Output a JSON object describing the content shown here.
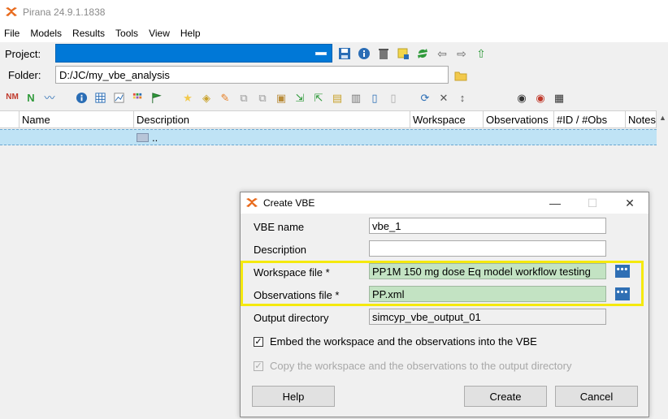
{
  "window": {
    "title": "Pirana 24.9.1.1838"
  },
  "menu": [
    "File",
    "Models",
    "Results",
    "Tools",
    "View",
    "Help"
  ],
  "project": {
    "label": "Project:",
    "value": ""
  },
  "folder": {
    "label": "Folder:",
    "value": "D:/JC/my_vbe_analysis"
  },
  "table": {
    "columns": [
      "Name",
      "Description",
      "Workspace",
      "Observations",
      "#ID / #Obs",
      "Notes"
    ],
    "parent_row": {
      "description": ".."
    }
  },
  "dialog": {
    "title": "Create VBE",
    "vbe_name": {
      "label": "VBE name",
      "value": "vbe_1"
    },
    "description": {
      "label": "Description",
      "value": ""
    },
    "workspace_file": {
      "label": "Workspace file *",
      "value": "PP1M 150 mg dose Eq model workflow testing"
    },
    "observations_file": {
      "label": "Observations file *",
      "value": "PP.xml"
    },
    "output_directory": {
      "label": "Output directory",
      "value": "simcyp_vbe_output_01"
    },
    "embed_checkbox": {
      "label": "Embed the workspace and the observations into the VBE",
      "checked": true
    },
    "copy_checkbox": {
      "label": "Copy the workspace and the observations to the output directory",
      "checked": true,
      "disabled": true
    },
    "buttons": {
      "help": "Help",
      "create": "Create",
      "cancel": "Cancel"
    },
    "dots_label": "•••"
  },
  "colors": {
    "selection": "#0078d7",
    "highlight": "#f5e90e",
    "green_field": "#c3e3c3",
    "row_selected": "#bfe3f5"
  }
}
